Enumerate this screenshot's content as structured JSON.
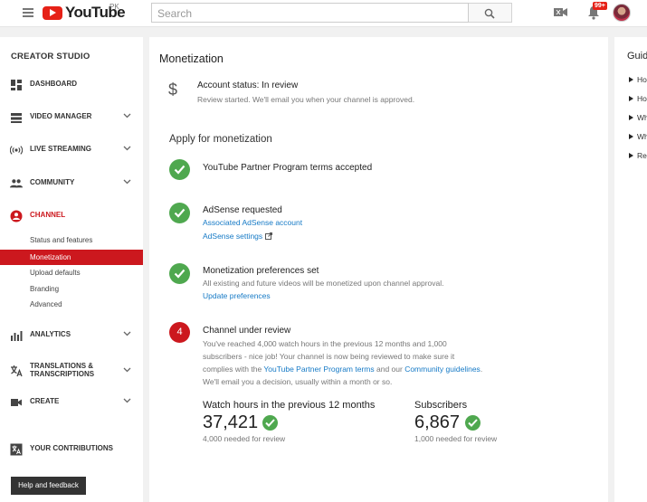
{
  "header": {
    "logo_text": "YouTube",
    "region": "PK",
    "search_placeholder": "Search",
    "notifications_badge": "99+"
  },
  "sidebar": {
    "title": "CREATOR STUDIO",
    "items": [
      {
        "label": "DASHBOARD",
        "icon": "dashboard-icon"
      },
      {
        "label": "VIDEO MANAGER",
        "icon": "video-manager-icon"
      },
      {
        "label": "LIVE STREAMING",
        "icon": "live-streaming-icon"
      },
      {
        "label": "COMMUNITY",
        "icon": "community-icon"
      },
      {
        "label": "CHANNEL",
        "icon": "channel-icon"
      },
      {
        "label": "ANALYTICS",
        "icon": "analytics-icon"
      },
      {
        "label": "TRANSLATIONS &",
        "label2": "TRANSCRIPTIONS",
        "icon": "translate-icon"
      },
      {
        "label": "CREATE",
        "icon": "create-icon"
      },
      {
        "label": "YOUR CONTRIBUTIONS",
        "icon": "contributions-icon"
      }
    ],
    "channel_sub": [
      "Status and features",
      "Monetization",
      "Upload defaults",
      "Branding",
      "Advanced"
    ],
    "help_button": "Help and feedback"
  },
  "main": {
    "title": "Monetization",
    "status": {
      "title": "Account status: In review",
      "subtitle": "Review started. We'll email you when your channel is approved."
    },
    "apply_title": "Apply for monetization",
    "steps": [
      {
        "title": "YouTube Partner Program terms accepted"
      },
      {
        "title": "AdSense requested",
        "link1": "Associated AdSense account",
        "link2": "AdSense settings"
      },
      {
        "title": "Monetization preferences set",
        "text": "All existing and future videos will be monetized upon channel approval.",
        "link": "Update preferences"
      },
      {
        "number": "4",
        "title": "Channel under review",
        "line1": "You've reached 4,000 watch hours in the previous 12 months and 1,000",
        "line2": "subscribers - nice job! Your channel is now being reviewed to make sure it",
        "line3_pre": "complies with the ",
        "line3_link1": "YouTube Partner Program terms",
        "line3_mid": " and our ",
        "line3_link2": "Community guidelines",
        "line3_post": ".",
        "line4": "We'll email you a decision, usually within a month or so."
      }
    ],
    "stats": {
      "watch_label": "Watch hours in the previous 12 months",
      "watch_value": "37,421",
      "watch_needed": "4,000 needed for review",
      "subs_label": "Subscribers",
      "subs_value": "6,867",
      "subs_needed": "1,000 needed for review"
    }
  },
  "guide": {
    "title": "Guid",
    "items": [
      "Ho",
      "Ho",
      "Wh",
      "Wh",
      "Re"
    ]
  }
}
